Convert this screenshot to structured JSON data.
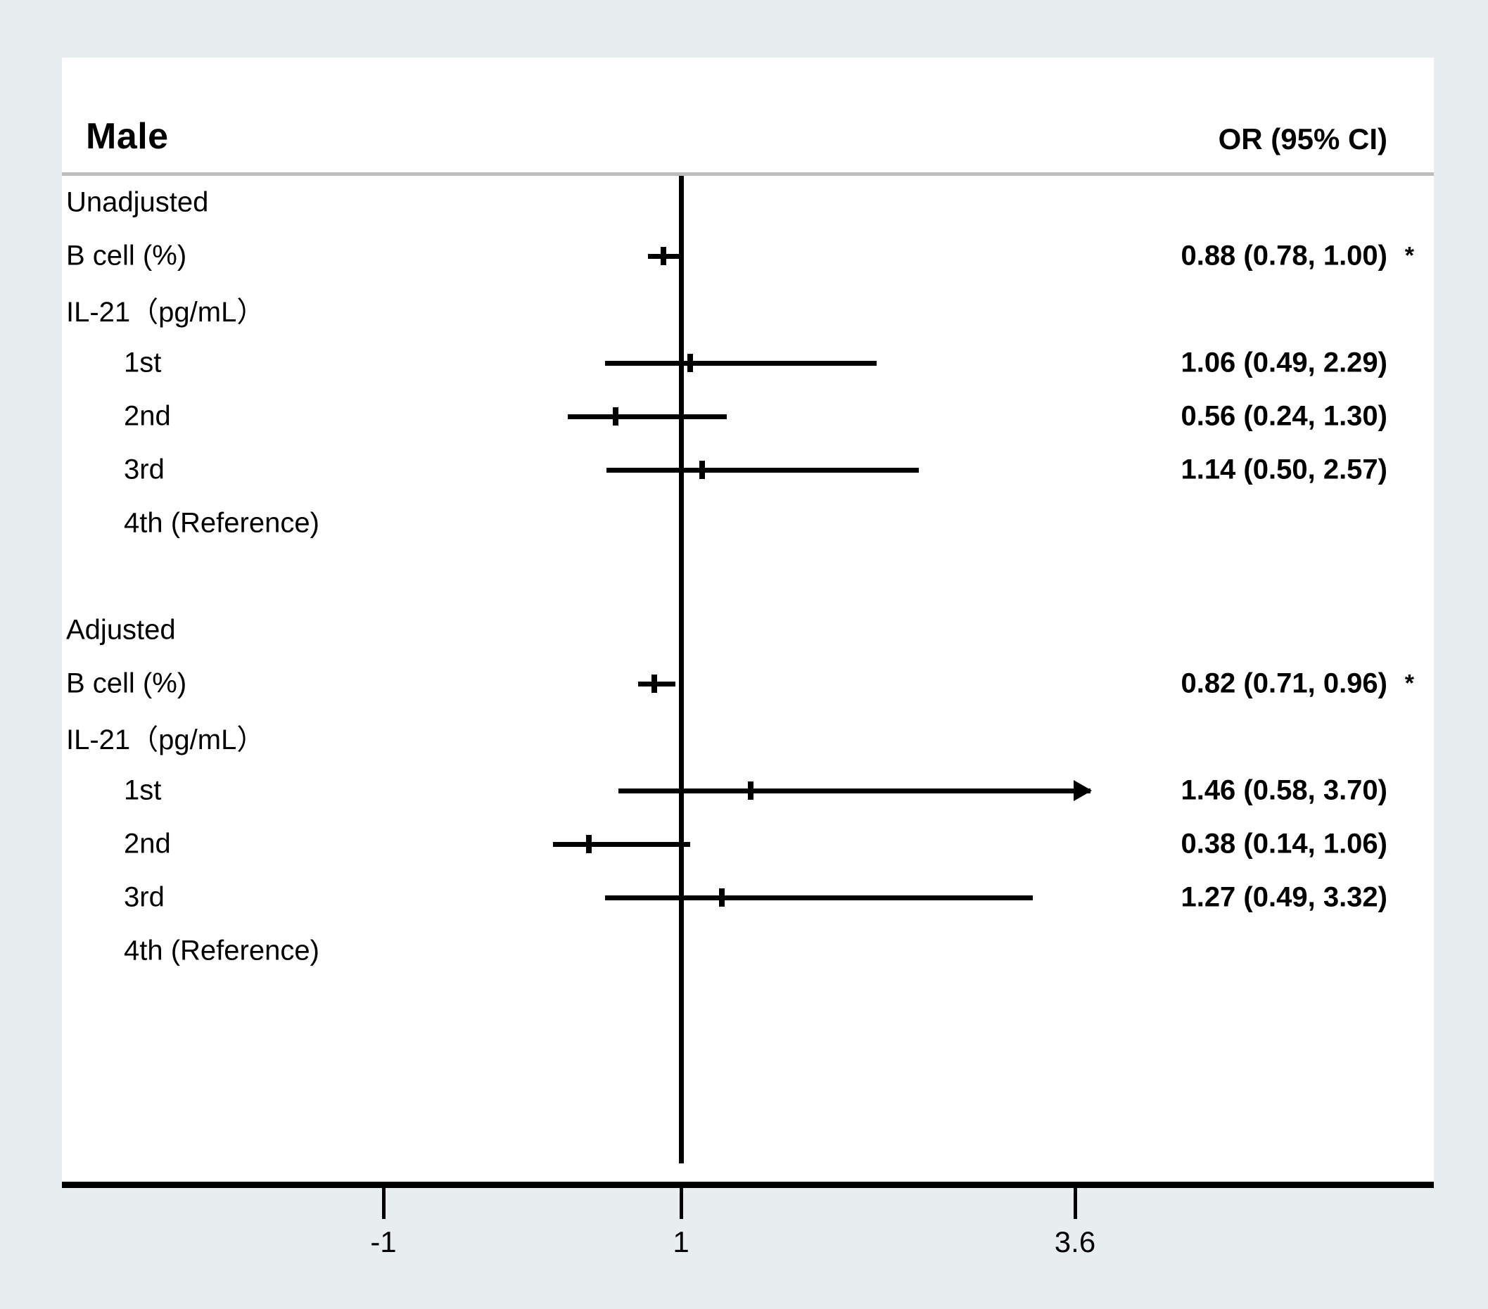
{
  "figure": {
    "title": "Male",
    "or_header": "OR (95% CI)",
    "background_color": "#e8eef0",
    "panel_color": "#ffffff",
    "line_color": "#000000"
  },
  "axis": {
    "ticks": [
      {
        "label": "-1",
        "value": -1,
        "x": 545
      },
      {
        "label": "1",
        "value": 1,
        "x": 968
      },
      {
        "label": "3.6",
        "value": 3.6,
        "x": 1528
      }
    ],
    "null_value": 1
  },
  "rows": [
    {
      "label": "Unadjusted",
      "indent": 0,
      "value": "",
      "star": "",
      "has_ci": false
    },
    {
      "label": "B cell (%)",
      "indent": 0,
      "value": "0.88 (0.78, 1.00)",
      "star": "*",
      "has_ci": true
    },
    {
      "label": "IL-21（pg/mL）",
      "indent": 0,
      "value": "",
      "star": "",
      "has_ci": false
    },
    {
      "label": "1st",
      "indent": 1,
      "value": "1.06 (0.49, 2.29)",
      "star": "",
      "has_ci": true
    },
    {
      "label": "2nd",
      "indent": 1,
      "value": "0.56 (0.24, 1.30)",
      "star": "",
      "has_ci": true
    },
    {
      "label": "3rd",
      "indent": 1,
      "value": "1.14 (0.50, 2.57)",
      "star": "",
      "has_ci": true
    },
    {
      "label": "4th (Reference)",
      "indent": 1,
      "value": "",
      "star": "",
      "has_ci": false
    },
    {
      "label": "",
      "indent": 0,
      "value": "",
      "star": "",
      "has_ci": false
    },
    {
      "label": "Adjusted",
      "indent": 0,
      "value": "",
      "star": "",
      "has_ci": false
    },
    {
      "label": "B cell (%)",
      "indent": 0,
      "value": "0.82 (0.71, 0.96)",
      "star": "*",
      "has_ci": true
    },
    {
      "label": "IL-21（pg/mL）",
      "indent": 0,
      "value": "",
      "star": "",
      "has_ci": false
    },
    {
      "label": "1st",
      "indent": 1,
      "value": "1.46 (0.58, 3.70)",
      "star": "",
      "has_ci": true
    },
    {
      "label": "2nd",
      "indent": 1,
      "value": "0.38 (0.14, 1.06)",
      "star": "",
      "has_ci": true
    },
    {
      "label": "3rd",
      "indent": 1,
      "value": "1.27 (0.49, 3.32)",
      "star": "",
      "has_ci": true
    },
    {
      "label": "4th (Reference)",
      "indent": 1,
      "value": "",
      "star": "",
      "has_ci": false
    }
  ],
  "chart_data": {
    "type": "scatter",
    "subtype": "forest-plot",
    "title": "Male",
    "xlabel": "",
    "ylabel": "",
    "effect_measure": "OR",
    "ci_level": "95%",
    "null_line": 1,
    "xticks": [
      -1,
      1,
      3.6
    ],
    "xticklabels": [
      "-1",
      "1",
      "3.6"
    ],
    "grid": false,
    "legend": null,
    "value_column_header": "OR (95% CI)",
    "significance_marker": "*",
    "groups": [
      {
        "name": "Unadjusted",
        "rows": [
          {
            "label": "B cell (%)",
            "indent": 0,
            "or": 0.88,
            "ci_low": 0.78,
            "ci_high": 1.0,
            "text": "0.88 (0.78, 1.00)",
            "significant": true,
            "truncated_right": false
          },
          {
            "label": "IL-21（pg/mL）",
            "indent": 0,
            "is_header": true
          },
          {
            "label": "1st",
            "indent": 1,
            "or": 1.06,
            "ci_low": 0.49,
            "ci_high": 2.29,
            "text": "1.06 (0.49, 2.29)",
            "significant": false,
            "truncated_right": false
          },
          {
            "label": "2nd",
            "indent": 1,
            "or": 0.56,
            "ci_low": 0.24,
            "ci_high": 1.3,
            "text": "0.56 (0.24, 1.30)",
            "significant": false,
            "truncated_right": false
          },
          {
            "label": "3rd",
            "indent": 1,
            "or": 1.14,
            "ci_low": 0.5,
            "ci_high": 2.57,
            "text": "1.14 (0.50, 2.57)",
            "significant": false,
            "truncated_right": false
          },
          {
            "label": "4th (Reference)",
            "indent": 1,
            "is_reference": true
          }
        ]
      },
      {
        "name": "Adjusted",
        "rows": [
          {
            "label": "B cell (%)",
            "indent": 0,
            "or": 0.82,
            "ci_low": 0.71,
            "ci_high": 0.96,
            "text": "0.82 (0.71, 0.96)",
            "significant": true,
            "truncated_right": false
          },
          {
            "label": "IL-21（pg/mL）",
            "indent": 0,
            "is_header": true
          },
          {
            "label": "1st",
            "indent": 1,
            "or": 1.46,
            "ci_low": 0.58,
            "ci_high": 3.7,
            "text": "1.46 (0.58, 3.70)",
            "significant": false,
            "truncated_right": true
          },
          {
            "label": "2nd",
            "indent": 1,
            "or": 0.38,
            "ci_low": 0.14,
            "ci_high": 1.06,
            "text": "0.38 (0.14, 1.06)",
            "significant": false,
            "truncated_right": false
          },
          {
            "label": "3rd",
            "indent": 1,
            "or": 1.27,
            "ci_low": 0.49,
            "ci_high": 3.32,
            "text": "1.27 (0.49, 3.32)",
            "significant": false,
            "truncated_right": false
          },
          {
            "label": "4th (Reference)",
            "indent": 1,
            "is_reference": true
          }
        ]
      }
    ]
  }
}
